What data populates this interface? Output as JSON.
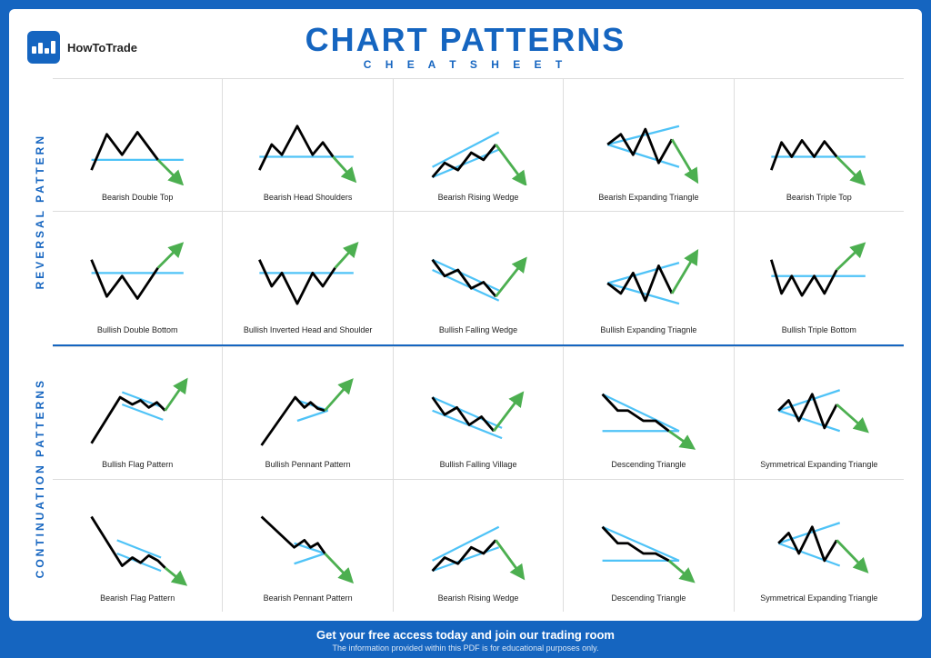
{
  "header": {
    "logo_text": "HowToTrade",
    "main_title": "CHART PATTERNS",
    "sub_title": "C H E A T   S H E E T"
  },
  "footer": {
    "main_text": "Get your free access today and join our trading room",
    "sub_text": "The information provided within this PDF is for educational purposes only."
  },
  "side_labels": {
    "reversal": "REVERSAL PATTERN",
    "continuation": "CONTINUATION PATTERNS"
  },
  "patterns": {
    "row1": [
      {
        "label": "Bearish Double Top"
      },
      {
        "label": "Bearish Head Shoulders"
      },
      {
        "label": "Bearish Rising Wedge"
      },
      {
        "label": "Bearish Expanding Triangle"
      },
      {
        "label": "Bearish Triple Top"
      }
    ],
    "row2": [
      {
        "label": "Bullish Double Bottom"
      },
      {
        "label": "Bullish Inverted Head and Shoulder"
      },
      {
        "label": "Bullish Falling Wedge"
      },
      {
        "label": "Bullish Expanding Triagnle"
      },
      {
        "label": "Bullish Triple Bottom"
      }
    ],
    "row3": [
      {
        "label": "Bullish Flag Pattern"
      },
      {
        "label": "Bullish Pennant Pattern"
      },
      {
        "label": "Bullish Falling Village"
      },
      {
        "label": "Descending Triangle"
      },
      {
        "label": "Symmetrical Expanding Triangle"
      }
    ],
    "row4": [
      {
        "label": "Bearish Flag Pattern"
      },
      {
        "label": "Bearish Pennant Pattern"
      },
      {
        "label": "Bearish Rising Wedge"
      },
      {
        "label": "Descending Triangle"
      },
      {
        "label": "Symmetrical Expanding Triangle"
      }
    ]
  }
}
